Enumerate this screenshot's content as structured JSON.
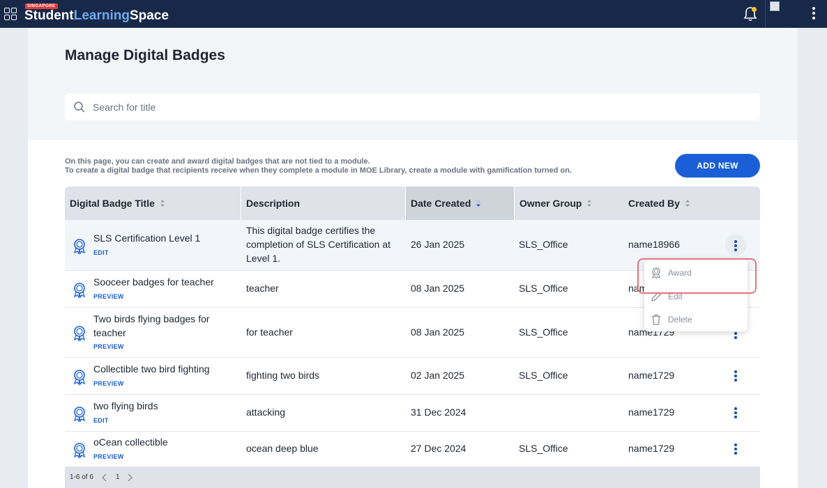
{
  "topbar": {
    "logo_tag": "SINGAPORE",
    "logo_word1": "Student",
    "logo_word2": "Learning",
    "logo_word3": "Space"
  },
  "page": {
    "title": "Manage Digital Badges",
    "search_placeholder": "Search for title",
    "info_line1": "On this page, you can create and award digital badges that are not tied to a module.",
    "info_line2": "To create a digital badge that recipients receive when they complete a module in MOE Library, create a module with gamification turned on.",
    "add_button": "ADD NEW"
  },
  "table": {
    "columns": [
      {
        "label": "Digital Badge Title",
        "sortable": true
      },
      {
        "label": "Description",
        "sortable": false
      },
      {
        "label": "Date Created",
        "sortable": true,
        "sorted": "desc"
      },
      {
        "label": "Owner Group",
        "sortable": true
      },
      {
        "label": "Created By",
        "sortable": true
      }
    ],
    "rows": [
      {
        "title": "SLS Certification Level 1",
        "link": "EDIT",
        "description": "This digital badge certifies the completion of SLS Certification at Level 1.",
        "date": "26 Jan 2025",
        "owner": "SLS_Office",
        "created_by": "name18966"
      },
      {
        "title": "Sooceer badges for teacher",
        "link": "PREVIEW",
        "description": "teacher",
        "date": "08 Jan 2025",
        "owner": "SLS_Office",
        "created_by": "nam"
      },
      {
        "title": "Two birds flying badges for teacher",
        "link": "PREVIEW",
        "description": "for teacher",
        "date": "08 Jan 2025",
        "owner": "SLS_Office",
        "created_by": "name1729"
      },
      {
        "title": "Collectible two bird fighting",
        "link": "PREVIEW",
        "description": "fighting two birds",
        "date": "02 Jan 2025",
        "owner": "SLS_Office",
        "created_by": "name1729"
      },
      {
        "title": "two flying birds",
        "link": "EDIT",
        "description": "attacking",
        "date": "31 Dec 2024",
        "owner": "",
        "created_by": "name1729"
      },
      {
        "title": "oCean collectible",
        "link": "PREVIEW",
        "description": "ocean deep blue",
        "date": "27 Dec 2024",
        "owner": "SLS_Office",
        "created_by": "name1729"
      }
    ]
  },
  "pagination": {
    "summary": "1-6 of 6",
    "page": "1"
  },
  "menu": {
    "award": "Award",
    "edit": "Edit",
    "delete": "Delete"
  },
  "colors": {
    "topbar": "#182848",
    "accent": "#1a5fd6",
    "highlight": "#e0767e"
  }
}
